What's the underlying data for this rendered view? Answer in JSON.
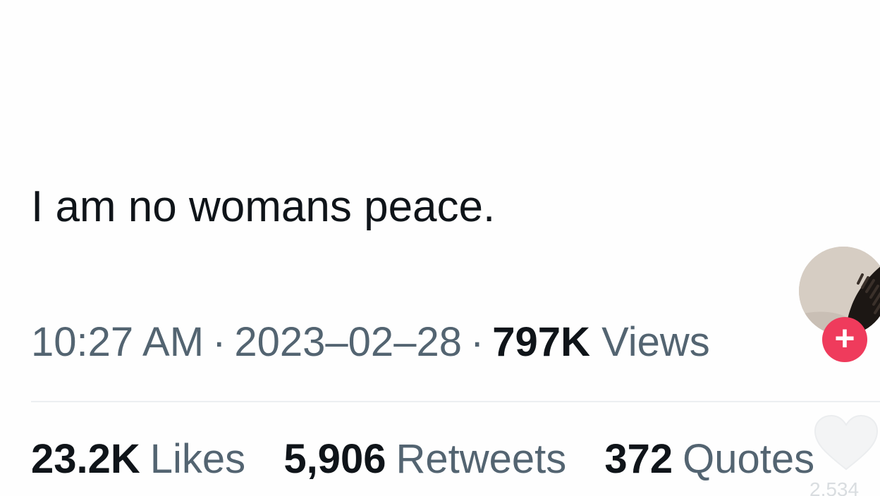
{
  "tweet": {
    "text": "I am no womans peace.",
    "time": "10:27 AM",
    "separator": "·",
    "date": "2023–02–28",
    "views_count": "797K",
    "views_label": "Views"
  },
  "stats": [
    {
      "value": "23.2K",
      "label": "Likes"
    },
    {
      "value": "5,906",
      "label": "Retweets"
    },
    {
      "value": "372",
      "label": "Quotes"
    }
  ],
  "overlay": {
    "follow_symbol": "+",
    "like_count": "2,534",
    "accent_color": "#ef3b5c"
  },
  "icons": [
    "plus-icon",
    "heart-icon"
  ]
}
